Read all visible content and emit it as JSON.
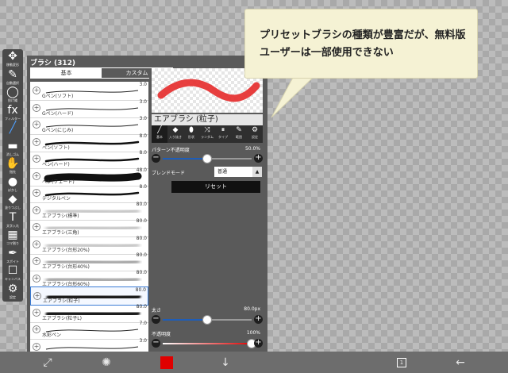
{
  "toolbar": {
    "tools": [
      {
        "icon": "move-transform-icon",
        "glyph": "✥",
        "label": "移動変形"
      },
      {
        "icon": "auto-select-icon",
        "glyph": "✎",
        "label": "自動選択"
      },
      {
        "icon": "lasso-icon",
        "glyph": "◯",
        "label": "投げ縄"
      },
      {
        "icon": "filter-icon",
        "glyph": "fx",
        "label": "フィルター"
      },
      {
        "icon": "brush-icon",
        "glyph": "╱",
        "label": ""
      },
      {
        "icon": "eraser-icon",
        "glyph": "▬",
        "label": "消しゴム"
      },
      {
        "icon": "smudge-icon",
        "glyph": "✋",
        "label": "指先"
      },
      {
        "icon": "blur-icon",
        "glyph": "●",
        "label": "ぼかし"
      },
      {
        "icon": "fill-icon",
        "glyph": "◆",
        "label": "塗りつぶし"
      },
      {
        "icon": "text-icon",
        "glyph": "T",
        "label": "文字入れ"
      },
      {
        "icon": "frame-divider-icon",
        "glyph": "▦",
        "label": "コマ割り"
      },
      {
        "icon": "eyedropper-icon",
        "glyph": "✒",
        "label": "スポイト"
      },
      {
        "icon": "canvas-icon",
        "glyph": "☐",
        "label": "キャンバス"
      },
      {
        "icon": "settings-icon",
        "glyph": "⚙",
        "label": "設定"
      }
    ]
  },
  "panel": {
    "title": "ブラシ (312)",
    "tab_basic": "基本",
    "tab_custom": "カスタム"
  },
  "brushes": [
    {
      "name": "Gペン(ソフト)",
      "size": "3.0",
      "kind": "thin"
    },
    {
      "name": "Gペン(ハード)",
      "size": "3.0",
      "kind": "thin"
    },
    {
      "name": "Gペン(にじみ)",
      "size": "3.0",
      "kind": "thin"
    },
    {
      "name": "ペン(ソフト)",
      "size": "8.0",
      "kind": "medium"
    },
    {
      "name": "ペン(ハード)",
      "size": "8.0",
      "kind": "medium"
    },
    {
      "name": "ペン(フェード)",
      "size": "48.0",
      "kind": "thick"
    },
    {
      "name": "デジタルペン",
      "size": "8.0",
      "kind": "medium"
    },
    {
      "name": "エアブラシ(標準)",
      "size": "80.0",
      "kind": "air-light"
    },
    {
      "name": "エアブラシ(三角)",
      "size": "80.0",
      "kind": "air-light"
    },
    {
      "name": "エアブラシ(台形20%)",
      "size": "80.0",
      "kind": "air-light"
    },
    {
      "name": "エアブラシ(台形40%)",
      "size": "80.0",
      "kind": "air-mid"
    },
    {
      "name": "エアブラシ(台形60%)",
      "size": "80.0",
      "kind": "air-mid"
    },
    {
      "name": "エアブラシ(粒子)",
      "size": "80.0",
      "kind": "air-dark",
      "selected": true
    },
    {
      "name": "エアブラシ(粒子L)",
      "size": "80.0",
      "kind": "air-dark"
    },
    {
      "name": "水彩ペン",
      "size": "7.0",
      "kind": "thin"
    },
    {
      "name": "",
      "size": "3.0",
      "kind": "thin"
    }
  ],
  "properties": {
    "brush_name": "エアブラシ (粒子)",
    "tabs": [
      {
        "icon": "basic-tab-icon",
        "glyph": "╱",
        "label": "基本"
      },
      {
        "icon": "entry-exit-tab-icon",
        "glyph": "◆",
        "label": "入り抜き"
      },
      {
        "icon": "shape-tab-icon",
        "glyph": "⬮",
        "label": "形状"
      },
      {
        "icon": "random-tab-icon",
        "glyph": "⤨",
        "label": "ランダム"
      },
      {
        "icon": "type-tab-icon",
        "glyph": "⏸",
        "label": "タイプ"
      },
      {
        "icon": "range-tab-icon",
        "glyph": "✎",
        "label": "範囲"
      },
      {
        "icon": "settings-tab-icon",
        "glyph": "⚙",
        "label": "設定"
      }
    ],
    "pattern_opacity_label": "パターン不透明度",
    "pattern_opacity_value": "50.0%",
    "pattern_opacity_level": 0.5,
    "blend_mode_label": "ブレンドモード",
    "blend_mode_value": "普通",
    "reset_label": "リセット",
    "size_label": "太さ",
    "size_value": "80.0px",
    "size_level": 0.5,
    "opacity_label": "不透明度",
    "opacity_value": "100%",
    "opacity_level": 1.0
  },
  "colors": {
    "current_color": "#e00000",
    "accent": "#1e5db8",
    "preview_stroke": "#e52a2a"
  },
  "bottom": {
    "icons": [
      "transform-icon",
      "brush-select-icon",
      "color-swatch",
      "download-icon",
      "layers-icon",
      "back-arrow-icon"
    ],
    "layer_count": "1"
  },
  "callout": {
    "text": "プリセットブラシの種類が豊富だが、無料版ユーザーは一部使用できない"
  }
}
